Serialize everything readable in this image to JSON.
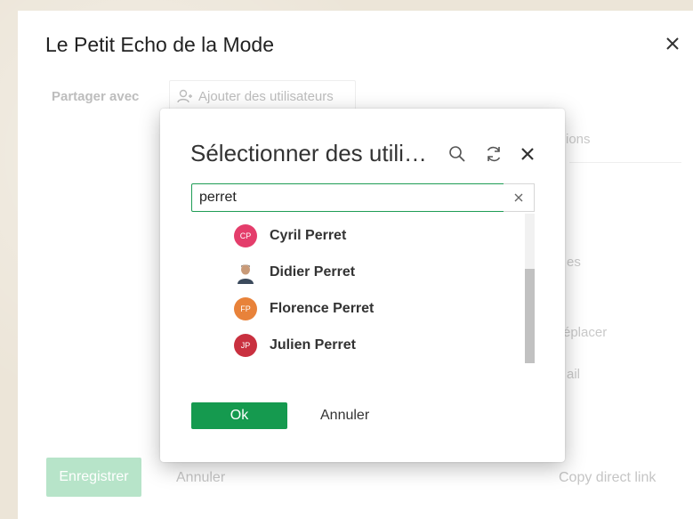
{
  "main": {
    "title": "Le Petit Echo de la Mode",
    "share_label": "Partager avec",
    "add_users_placeholder": "Ajouter des utilisateurs",
    "ghost_options": "ions",
    "ghost_es": "es",
    "ghost_replace": "éplacer",
    "ghost_mail": "ail",
    "save_label": "Enregistrer",
    "cancel_label": "Annuler",
    "copy_link_label": "Copy direct link"
  },
  "modal": {
    "title": "Sélectionner des utilisateurs",
    "search_value": "perret",
    "results": [
      {
        "name": "Cyril Perret",
        "initials": "CP",
        "color": "#e43d6b",
        "photo": false
      },
      {
        "name": "Didier Perret",
        "initials": "",
        "color": "#ffffff",
        "photo": true
      },
      {
        "name": "Florence Perret",
        "initials": "FP",
        "color": "#e8823a",
        "photo": false
      },
      {
        "name": "Julien Perret",
        "initials": "JP",
        "color": "#c9303f",
        "photo": false
      }
    ],
    "ok_label": "Ok",
    "cancel_label": "Annuler"
  },
  "colors": {
    "accent": "#159a4f",
    "disabled_accent": "#b7e4c9"
  }
}
